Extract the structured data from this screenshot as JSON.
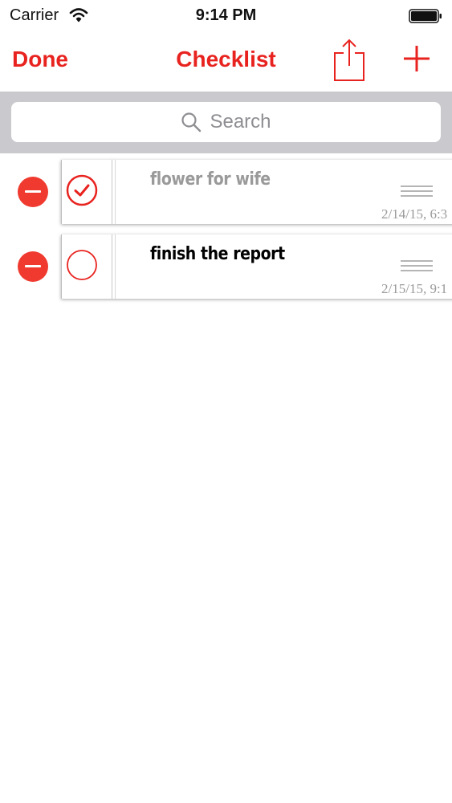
{
  "status_bar": {
    "carrier": "Carrier",
    "time": "9:14 PM",
    "wifi_icon": "wifi-icon",
    "battery_icon": "battery-full-icon"
  },
  "nav": {
    "done_label": "Done",
    "title": "Checklist",
    "share_icon": "share-icon",
    "add_icon": "plus-icon"
  },
  "search": {
    "placeholder": "Search",
    "icon": "search-icon"
  },
  "colors": {
    "accent": "#e8231f",
    "delete": "#f03a2f",
    "completed_text": "#9a9a9a",
    "open_text": "#000000",
    "search_bar_bg": "#c9c9ce"
  },
  "items": [
    {
      "title": "flower for wife",
      "date": "2/14/15, 6:3",
      "checked": true
    },
    {
      "title": "finish the report",
      "date": "2/15/15, 9:1",
      "checked": false
    }
  ]
}
